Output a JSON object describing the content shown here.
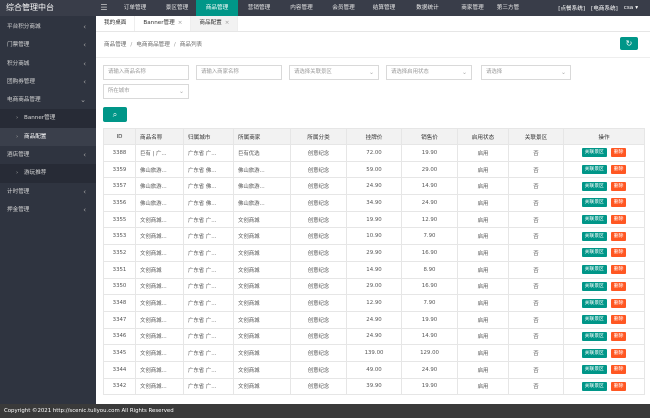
{
  "app": {
    "title": "综合管理中台",
    "menu_icon": "menu-icon"
  },
  "topnav": [
    {
      "label": "订单管理",
      "w": 46
    },
    {
      "label": "景区管理",
      "w": 38
    },
    {
      "label": "商品管理",
      "w": 42,
      "active": true
    },
    {
      "label": "营销管理",
      "w": 42
    },
    {
      "label": "内容管理",
      "w": 43
    },
    {
      "label": "会员管理",
      "w": 41
    },
    {
      "label": "结算管理",
      "w": 40
    },
    {
      "label": "数据统计",
      "w": 47
    },
    {
      "label": "商家管理",
      "w": 43
    },
    {
      "label": "第三方管",
      "w": 28
    }
  ],
  "top_right": {
    "system1": "[点餐系统]",
    "system2": "[电商系统]",
    "user": "csa"
  },
  "sidebar": [
    {
      "label": "平台积分商城",
      "arrow": true
    },
    {
      "label": "门票管理",
      "arrow": true
    },
    {
      "label": "积分商城",
      "arrow": true
    },
    {
      "label": "团购券管理",
      "arrow": true
    },
    {
      "label": "电商商品管理",
      "arrow": "down"
    },
    {
      "label": "Banner管理",
      "sub": true
    },
    {
      "label": "商品配置",
      "sub": true,
      "active": true
    },
    {
      "label": "酒店管理",
      "arrow": true
    },
    {
      "label": "游玩推荐",
      "sub": true
    },
    {
      "label": "计时管理",
      "arrow": true
    },
    {
      "label": "押金管理",
      "arrow": true
    }
  ],
  "tabs": [
    {
      "label": "我的桌面"
    },
    {
      "label": "Banner管理",
      "close": "×"
    },
    {
      "label": "商品配置",
      "close": "×",
      "active": true
    }
  ],
  "breadcrumb": [
    "商品管理",
    "电商商品管理",
    "商品列表"
  ],
  "filters": {
    "product_name": "请输入商品名称",
    "merchant_name": "请输入商家名称",
    "scenic": "请选择关联景区",
    "status": "请选择启用状态",
    "select": "请选择",
    "city": "所在城市"
  },
  "table": {
    "headers": [
      "ID",
      "商品名称",
      "归属城市",
      "所属商家",
      "所属分类",
      "挂牌价",
      "销售价",
      "启用状态",
      "关联景区",
      "操作"
    ],
    "action_link": "关联景区",
    "action_delete": "删除",
    "rows": [
      [
        "3388",
        "巨有 | 广...",
        "广东省 广...",
        "巨有优选",
        "创意纪念",
        "72.00",
        "19.90",
        "启用",
        "否"
      ],
      [
        "3359",
        "佛山旅游...",
        "广东省 佛...",
        "佛山旅游...",
        "创意纪念",
        "59.00",
        "29.00",
        "启用",
        "否"
      ],
      [
        "3357",
        "佛山旅游...",
        "广东省 佛...",
        "佛山旅游...",
        "创意纪念",
        "24.90",
        "14.90",
        "启用",
        "否"
      ],
      [
        "3356",
        "佛山旅游...",
        "广东省 佛...",
        "佛山旅游...",
        "创意纪念",
        "34.90",
        "24.90",
        "启用",
        "否"
      ],
      [
        "3355",
        "文创商城...",
        "广东省 广...",
        "文创商城",
        "创意纪念",
        "19.90",
        "12.90",
        "启用",
        "否"
      ],
      [
        "3353",
        "文创商城...",
        "广东省 广...",
        "文创商城",
        "创意纪念",
        "10.90",
        "7.90",
        "启用",
        "否"
      ],
      [
        "3352",
        "文创商城...",
        "广东省 广...",
        "文创商城",
        "创意纪念",
        "29.90",
        "16.90",
        "启用",
        "否"
      ],
      [
        "3351",
        "文创商城",
        "广东省 广...",
        "文创商城",
        "创意纪念",
        "14.90",
        "8.90",
        "启用",
        "否"
      ],
      [
        "3350",
        "文创商城...",
        "广东省 广...",
        "文创商城",
        "创意纪念",
        "29.00",
        "16.90",
        "启用",
        "否"
      ],
      [
        "3348",
        "文创商城...",
        "广东省 广...",
        "文创商城",
        "创意纪念",
        "12.90",
        "7.90",
        "启用",
        "否"
      ],
      [
        "3347",
        "文创商城...",
        "广东省 广...",
        "文创商城",
        "创意纪念",
        "24.90",
        "19.90",
        "启用",
        "否"
      ],
      [
        "3346",
        "文创商城...",
        "广东省 广...",
        "文创商城",
        "创意纪念",
        "24.90",
        "14.90",
        "启用",
        "否"
      ],
      [
        "3345",
        "文创商城...",
        "广东省 广...",
        "文创商城",
        "创意纪念",
        "139.00",
        "129.00",
        "启用",
        "否"
      ],
      [
        "3344",
        "文创商城...",
        "广东省 广...",
        "文创商城",
        "创意纪念",
        "49.00",
        "24.90",
        "启用",
        "否"
      ],
      [
        "3342",
        "文创商城...",
        "广东省 广...",
        "文创商城",
        "创意纪念",
        "39.90",
        "19.90",
        "启用",
        "否"
      ]
    ]
  },
  "footer": "Copyright ©2021 http://scenic.tuliyou.com All Rights Reserved"
}
